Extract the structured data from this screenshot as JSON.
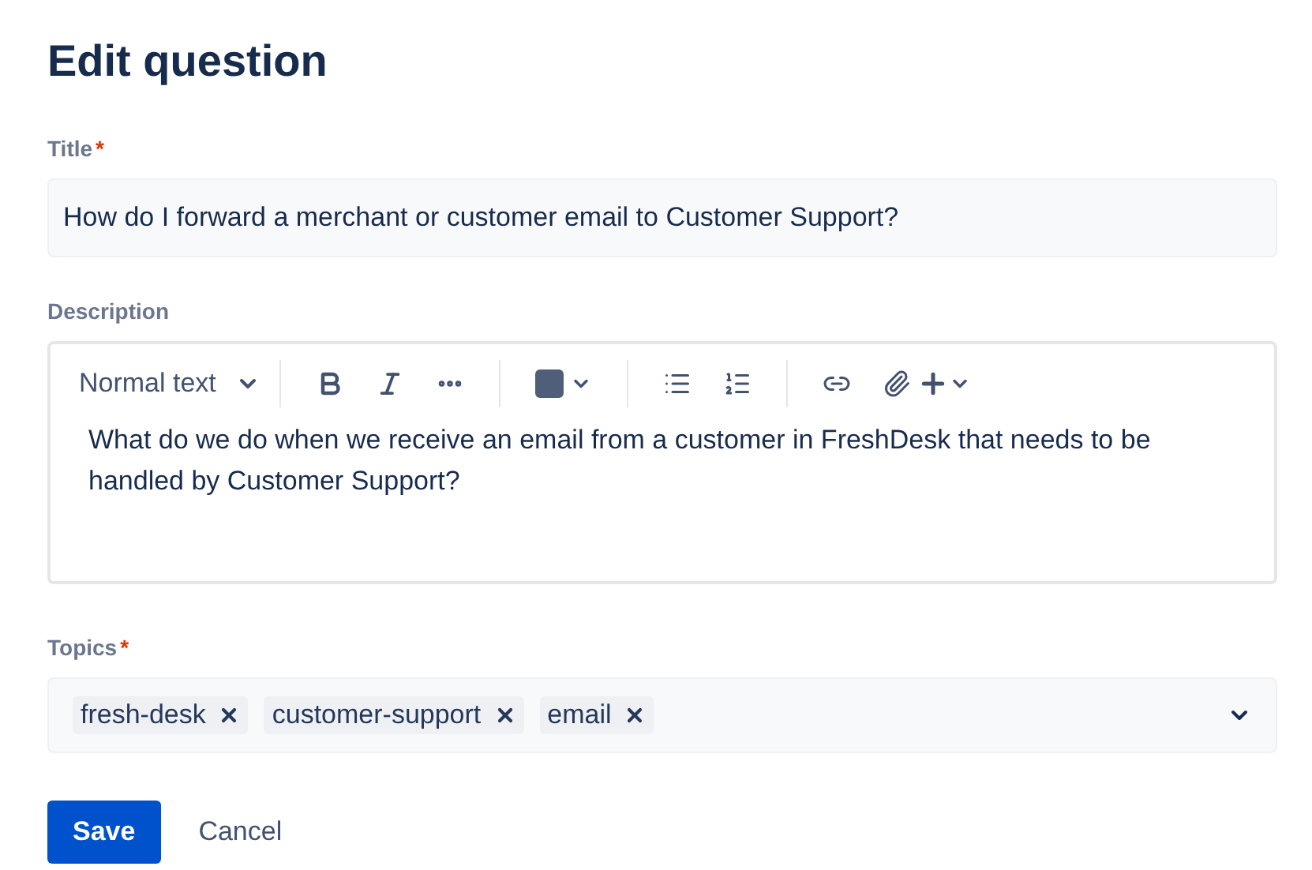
{
  "heading": "Edit question",
  "title_field": {
    "label": "Title",
    "required_mark": "*",
    "value": "How do I forward a merchant or customer email to Customer Support?"
  },
  "description": {
    "label": "Description",
    "text_style": "Normal text",
    "value": "What do we do when we receive an email from a customer in FreshDesk that needs to be handled by Customer Support?"
  },
  "topics": {
    "label": "Topics",
    "required_mark": "*",
    "tags": [
      "fresh-desk",
      "customer-support",
      "email"
    ]
  },
  "buttons": [
    {
      "label": "Save",
      "kind": "primary"
    },
    {
      "label": "Cancel",
      "kind": "subtle"
    }
  ]
}
